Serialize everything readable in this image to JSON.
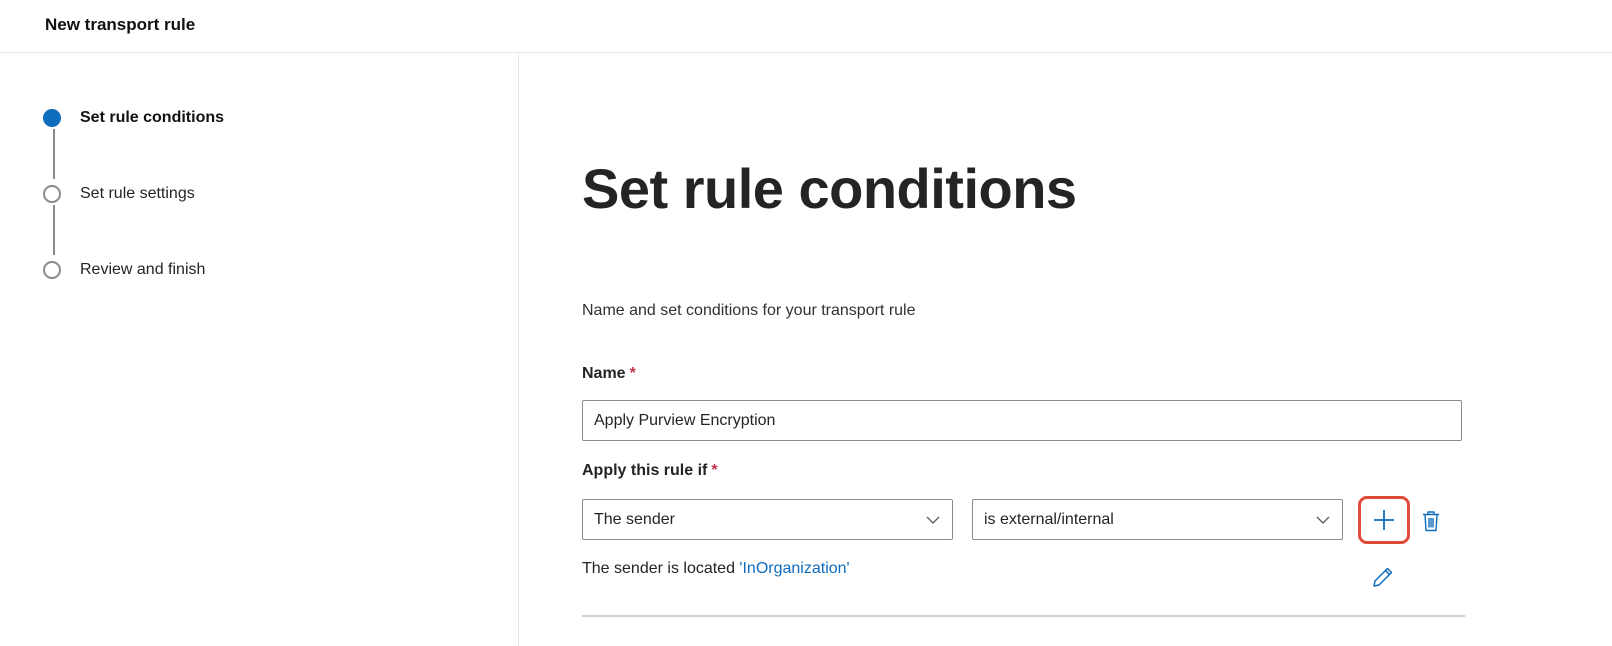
{
  "header": {
    "title": "New transport rule"
  },
  "wizard": {
    "steps": [
      {
        "label": "Set rule conditions",
        "state": "current"
      },
      {
        "label": "Set rule settings",
        "state": "upcoming"
      },
      {
        "label": "Review and finish",
        "state": "upcoming"
      }
    ]
  },
  "main": {
    "heading": "Set rule conditions",
    "description": "Name and set conditions for your transport rule",
    "name_field": {
      "label": "Name",
      "required_mark": "*",
      "value": "Apply Purview Encryption"
    },
    "condition": {
      "label": "Apply this rule if",
      "required_mark": "*",
      "subject_select": {
        "value": "The sender"
      },
      "predicate_select": {
        "value": "is external/internal"
      },
      "summary_text": "The sender is located ",
      "summary_link": "'InOrganization'"
    }
  },
  "icons": {
    "add": "plus-icon",
    "delete": "trash-icon",
    "edit": "pencil-icon",
    "dropdown": "chevron-down-icon"
  },
  "colors": {
    "accent": "#0f6cbd",
    "required": "#c4314b",
    "highlight": "#e04a3a"
  }
}
